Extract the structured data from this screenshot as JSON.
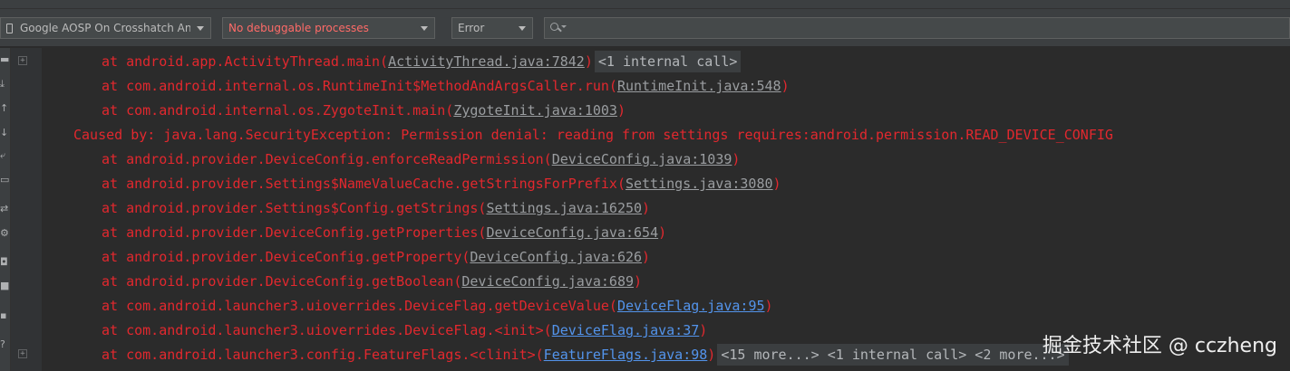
{
  "toolbar": {
    "device": "Google AOSP On Crosshatch An",
    "process": "No debuggable processes",
    "level": "Error",
    "search_value": ""
  },
  "side_icons": [
    "trash-icon",
    "scroll-to-end-icon",
    "up-arrow-icon",
    "down-arrow-icon",
    "soft-wrap-icon",
    "print-icon",
    "restart-icon",
    "settings-icon",
    "screenshot-icon",
    "screen-record-icon",
    "stop-icon",
    "help-icon"
  ],
  "log": {
    "lines": [
      {
        "pre": "at android.app.ActivityThread.main(",
        "link": "ActivityThread.java:7842",
        "post": ")",
        "chip": "<1 internal call>",
        "fold": true
      },
      {
        "pre": "at com.android.internal.os.RuntimeInit$MethodAndArgsCaller.run(",
        "link": "RuntimeInit.java:548",
        "post": ")"
      },
      {
        "pre": "at com.android.internal.os.ZygoteInit.main(",
        "link": "ZygoteInit.java:1003",
        "post": ")"
      },
      {
        "pre": "Caused by: java.lang.SecurityException: Permission denial: reading from settings requires:android.permission.READ_DEVICE_CONFIG",
        "indent": false
      },
      {
        "pre": "at android.provider.DeviceConfig.enforceReadPermission(",
        "link": "DeviceConfig.java:1039",
        "post": ")"
      },
      {
        "pre": "at android.provider.Settings$NameValueCache.getStringsForPrefix(",
        "link": "Settings.java:3080",
        "post": ")"
      },
      {
        "pre": "at android.provider.Settings$Config.getStrings(",
        "link": "Settings.java:16250",
        "post": ")"
      },
      {
        "pre": "at android.provider.DeviceConfig.getProperties(",
        "link": "DeviceConfig.java:654",
        "post": ")"
      },
      {
        "pre": "at android.provider.DeviceConfig.getProperty(",
        "link": "DeviceConfig.java:626",
        "post": ")"
      },
      {
        "pre": "at android.provider.DeviceConfig.getBoolean(",
        "link": "DeviceConfig.java:689",
        "post": ")"
      },
      {
        "pre": "at com.android.launcher3.uioverrides.DeviceFlag.getDeviceValue(",
        "link": "DeviceFlag.java:95",
        "post": ")",
        "blue": true
      },
      {
        "pre": "at com.android.launcher3.uioverrides.DeviceFlag.<init>(",
        "link": "DeviceFlag.java:37",
        "post": ")",
        "blue": true
      },
      {
        "pre": "at com.android.launcher3.config.FeatureFlags.<clinit>(",
        "link": "FeatureFlags.java:98",
        "post": ")",
        "blue": true,
        "chip": "<15 more...> <1 internal call> <2 more...>",
        "fold": true
      }
    ]
  },
  "colors": {
    "error_text": "#e2282e",
    "link_gray": "#9a9da0",
    "link_blue": "#5394ec",
    "background": "#2b2b2b"
  },
  "watermark": "掘金技术社区 @ cczheng"
}
